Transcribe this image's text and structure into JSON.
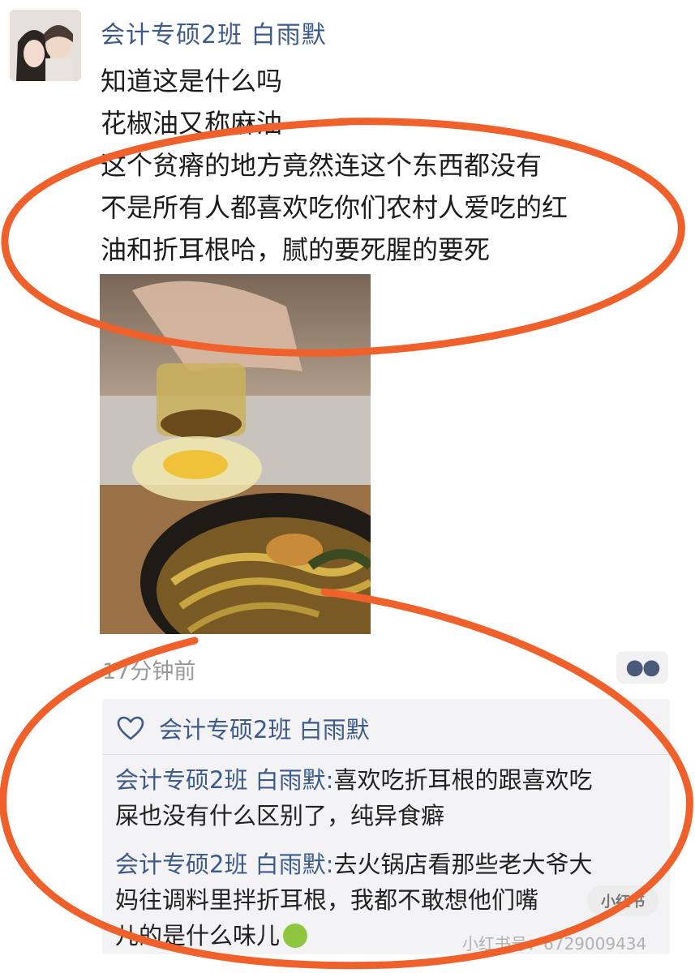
{
  "post": {
    "author": "会计专硕2班  白雨默",
    "lines": [
      "知道这是什么吗",
      "花椒油又称麻油",
      "这个贫瘠的地方竟然连这个东西都没有",
      "不是所有人都喜欢吃你们农村人爱吃的红",
      "油和折耳根哈，腻的要死腥的要死"
    ],
    "timestamp": "17分钟前",
    "more_icon": "more-dots-icon"
  },
  "likes": {
    "icon": "heart-icon",
    "names": "会计专硕2班  白雨默"
  },
  "comments": [
    {
      "author": "会计专硕2班  白雨默:",
      "line1": "喜欢吃折耳根的跟喜欢吃",
      "line2": "屎也没有什么区别了，纯异食癖"
    },
    {
      "author": "会计专硕2班  白雨默:",
      "line1": "去火锅店看那些老大爷大",
      "line2": "妈往调料里拌折耳根，我都不敢想他们嘴",
      "line3": "儿的是什么味儿",
      "emoji": "nauseated-face-icon"
    }
  ],
  "watermark": {
    "badge": "小红书",
    "id": "小红书号：6729009434"
  },
  "colors": {
    "name_blue": "#3c5a8a",
    "annotation_orange": "#f0602a",
    "comment_bg": "#f3f3f5"
  }
}
